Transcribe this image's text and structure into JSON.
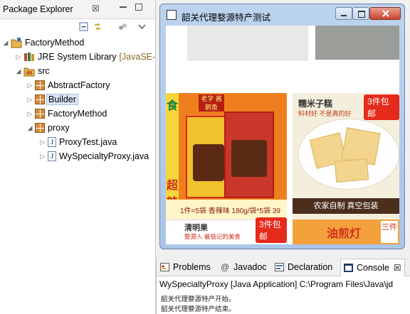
{
  "explorer": {
    "title": "Package Explorer",
    "close_glyph": "☒",
    "tree": [
      {
        "label": "FactoryMethod",
        "level": 0,
        "icon": "project-icon",
        "twisty": "expanded"
      },
      {
        "label": "JRE System Library",
        "suffix": "[JavaSE-",
        "level": 1,
        "icon": "library-icon",
        "twisty": "collapsed"
      },
      {
        "label": "src",
        "level": 1,
        "icon": "source-folder-icon",
        "twisty": "expanded"
      },
      {
        "label": "AbstractFactory",
        "level": 2,
        "icon": "package-icon",
        "twisty": "collapsed"
      },
      {
        "label": "Builder",
        "level": 2,
        "icon": "package-icon",
        "twisty": "collapsed",
        "selected": true
      },
      {
        "label": "FactoryMethod",
        "level": 2,
        "icon": "package-icon",
        "twisty": "collapsed"
      },
      {
        "label": "proxy",
        "level": 2,
        "icon": "package-icon",
        "twisty": "expanded"
      },
      {
        "label": "ProxyTest.java",
        "level": 3,
        "icon": "java-file-icon",
        "twisty": "collapsed"
      },
      {
        "label": "WySpecialtyProxy.java",
        "level": 3,
        "icon": "java-file-icon",
        "twisty": "collapsed"
      }
    ]
  },
  "app_window": {
    "title": "韶关代理婺源特产测试",
    "products": {
      "left_header": "老字\n酱鹅鱼",
      "left_side_chars": [
        "食",
        "超",
        "辣"
      ],
      "left_promo": "1件=5袋 香辣味 180g/袋*5袋 39",
      "right_header": "糯米子糕",
      "right_subheader": "料材好 不是真的好",
      "right_ribbon": "农家自制 真空包装",
      "badge_label": "3件包邮",
      "bottom_left": "清明果",
      "bottom_left_sub": "婺源人 最惦记的美食",
      "bottom_right": "油煎灯",
      "bottom_right_side": "三件"
    }
  },
  "console": {
    "tabs": [
      {
        "label": "Problems",
        "icon": "problems-icon"
      },
      {
        "label": "Javadoc",
        "icon": "javadoc-icon"
      },
      {
        "label": "Declaration",
        "icon": "declaration-icon"
      },
      {
        "label": "Console",
        "icon": "console-icon",
        "active": true
      }
    ],
    "close_glyph": "☒",
    "description": "WySpecialtyProxy [Java Application] C:\\Program Files\\Java\\jd",
    "lines": [
      "韶关代理婺源特产开始。",
      "韶关代理婺源特产结束。"
    ]
  }
}
